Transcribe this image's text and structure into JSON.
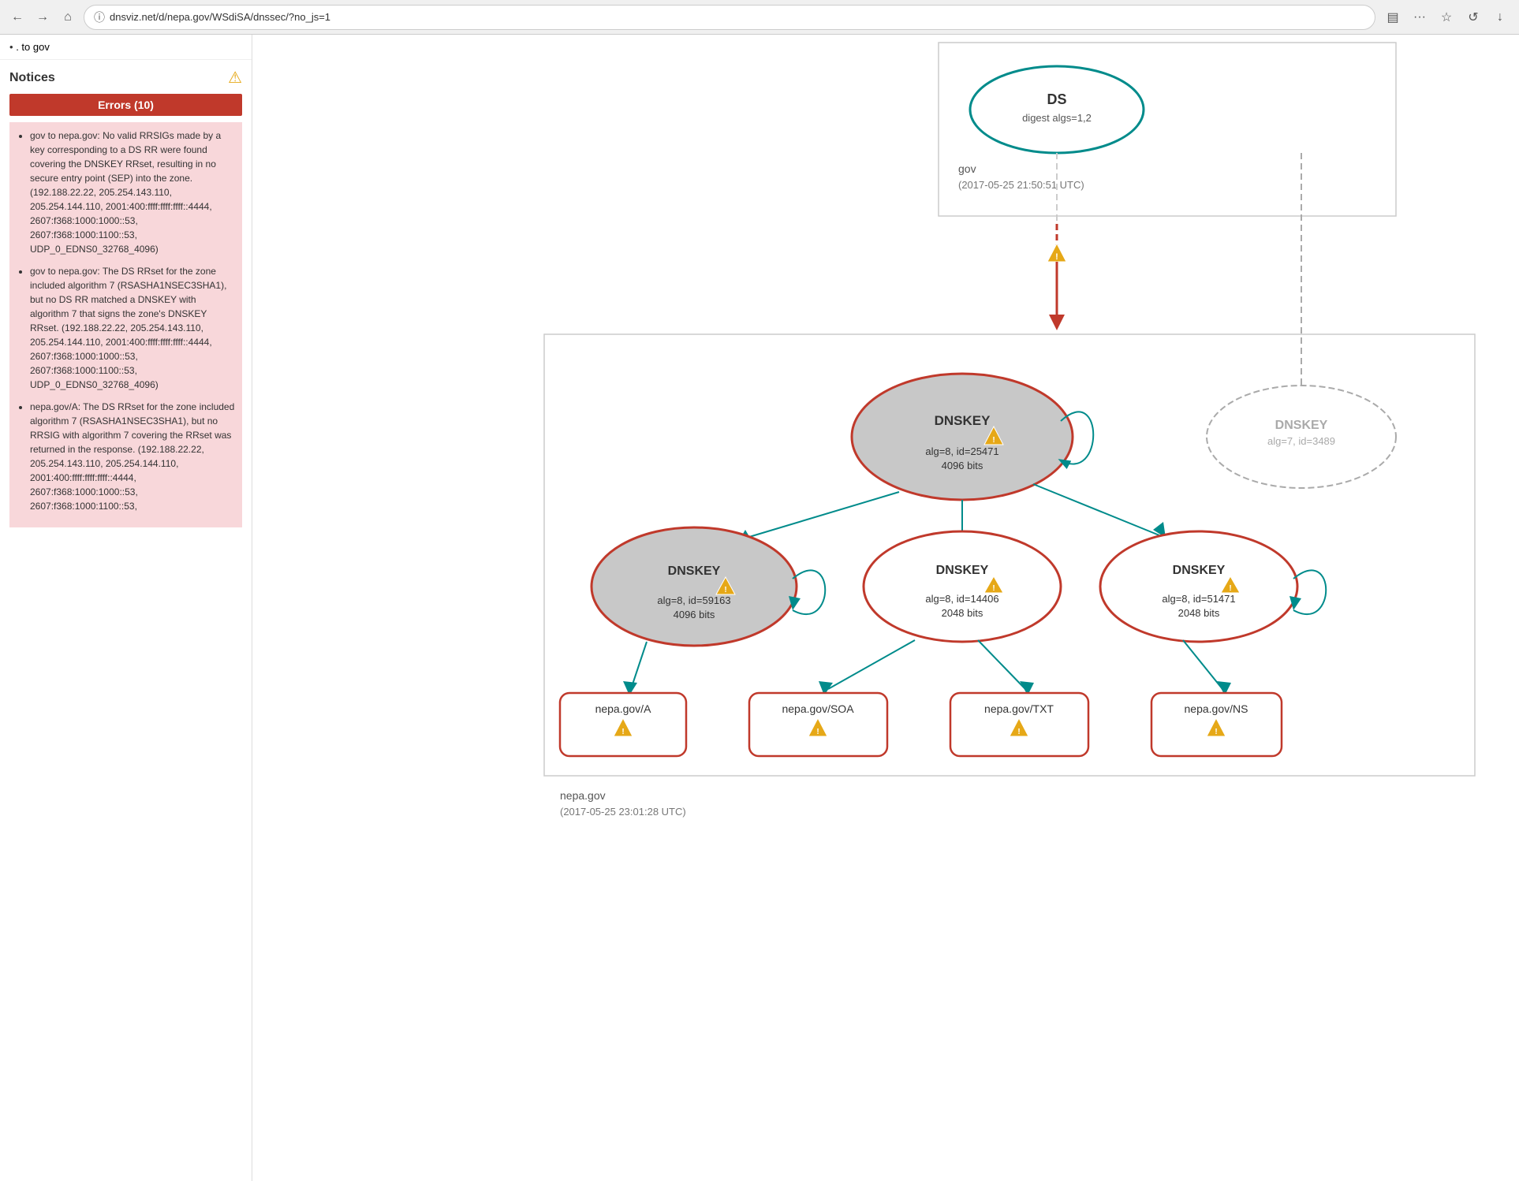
{
  "browser": {
    "back_btn": "←",
    "forward_btn": "→",
    "home_btn": "⌂",
    "url": "dnsviz.net/d/nepa.gov/WSdiSA/dnssec/?no_js=1",
    "secure_icon": "ⓘ",
    "reader_icon": "▤",
    "menu_btn": "···",
    "bookmark_icon": "☆",
    "refresh_icon": "↺",
    "download_icon": "↓"
  },
  "sidebar": {
    "top_link": ". to gov",
    "notices_title": "Notices",
    "warning_icon": "⚠",
    "errors_bar": "Errors (10)",
    "errors": [
      "gov to nepa.gov: No valid RRSIGs made by a key corresponding to a DS RR were found covering the DNSKEY RRset, resulting in no secure entry point (SEP) into the zone. (192.188.22.22, 205.254.143.110, 205.254.144.110, 2001:400:ffff:ffff:ffff::4444, 2607:f368:1000:1000::53, 2607:f368:1000:1100::53, UDP_0_EDNS0_32768_4096)",
      "gov to nepa.gov: The DS RRset for the zone included algorithm 7 (RSASHA1NSEC3SHA1), but no DS RR matched a DNSKEY with algorithm 7 that signs the zone's DNSKEY RRset. (192.188.22.22, 205.254.143.110, 205.254.144.110, 2001:400:ffff:ffff:ffff::4444, 2607:f368:1000:1000::53, 2607:f368:1000:1100::53, UDP_0_EDNS0_32768_4096)",
      "nepa.gov/A: The DS RRset for the zone included algorithm 7 (RSASHA1NSEC3SHA1), but no RRSIG with algorithm 7 covering the RRset was returned in the response. (192.188.22.22, 205.254.143.110, 205.254.144.110, 2001:400:ffff:ffff:ffff::4444, 2607:f368:1000:1000::53, 2607:f368:1000:1100::53,"
    ]
  },
  "diagram": {
    "gov_zone": "gov",
    "gov_timestamp": "(2017-05-25 21:50:51 UTC)",
    "ds_label": "DS",
    "ds_digest": "digest algs=1,2",
    "nepagov_zone": "nepa.gov",
    "nepagov_timestamp": "(2017-05-25 23:01:28 UTC)",
    "dnskey_1": {
      "label": "DNSKEY",
      "detail": "alg=8, id=25471",
      "bits": "4096 bits",
      "has_warning": true,
      "style": "filled_gray"
    },
    "dnskey_2": {
      "label": "DNSKEY",
      "detail": "alg=7, id=3489",
      "has_warning": false,
      "style": "dashed"
    },
    "dnskey_3": {
      "label": "DNSKEY",
      "detail": "alg=8, id=59163",
      "bits": "4096 bits",
      "has_warning": true,
      "style": "filled_gray"
    },
    "dnskey_4": {
      "label": "DNSKEY",
      "detail": "alg=8, id=14406",
      "bits": "2048 bits",
      "has_warning": true,
      "style": "filled_white"
    },
    "dnskey_5": {
      "label": "DNSKEY",
      "detail": "alg=8, id=51471",
      "bits": "2048 bits",
      "has_warning": true,
      "style": "filled_white"
    },
    "rrset_A": "nepa.gov/A",
    "rrset_SOA": "nepa.gov/SOA",
    "rrset_TXT": "nepa.gov/TXT",
    "rrset_NS": "nepa.gov/NS",
    "colors": {
      "teal": "#008b8b",
      "red": "#c0392b",
      "gray": "#aaa",
      "light_gray_fill": "#d3d3d3",
      "white_fill": "#fff",
      "error_red": "#e74c3c"
    }
  }
}
